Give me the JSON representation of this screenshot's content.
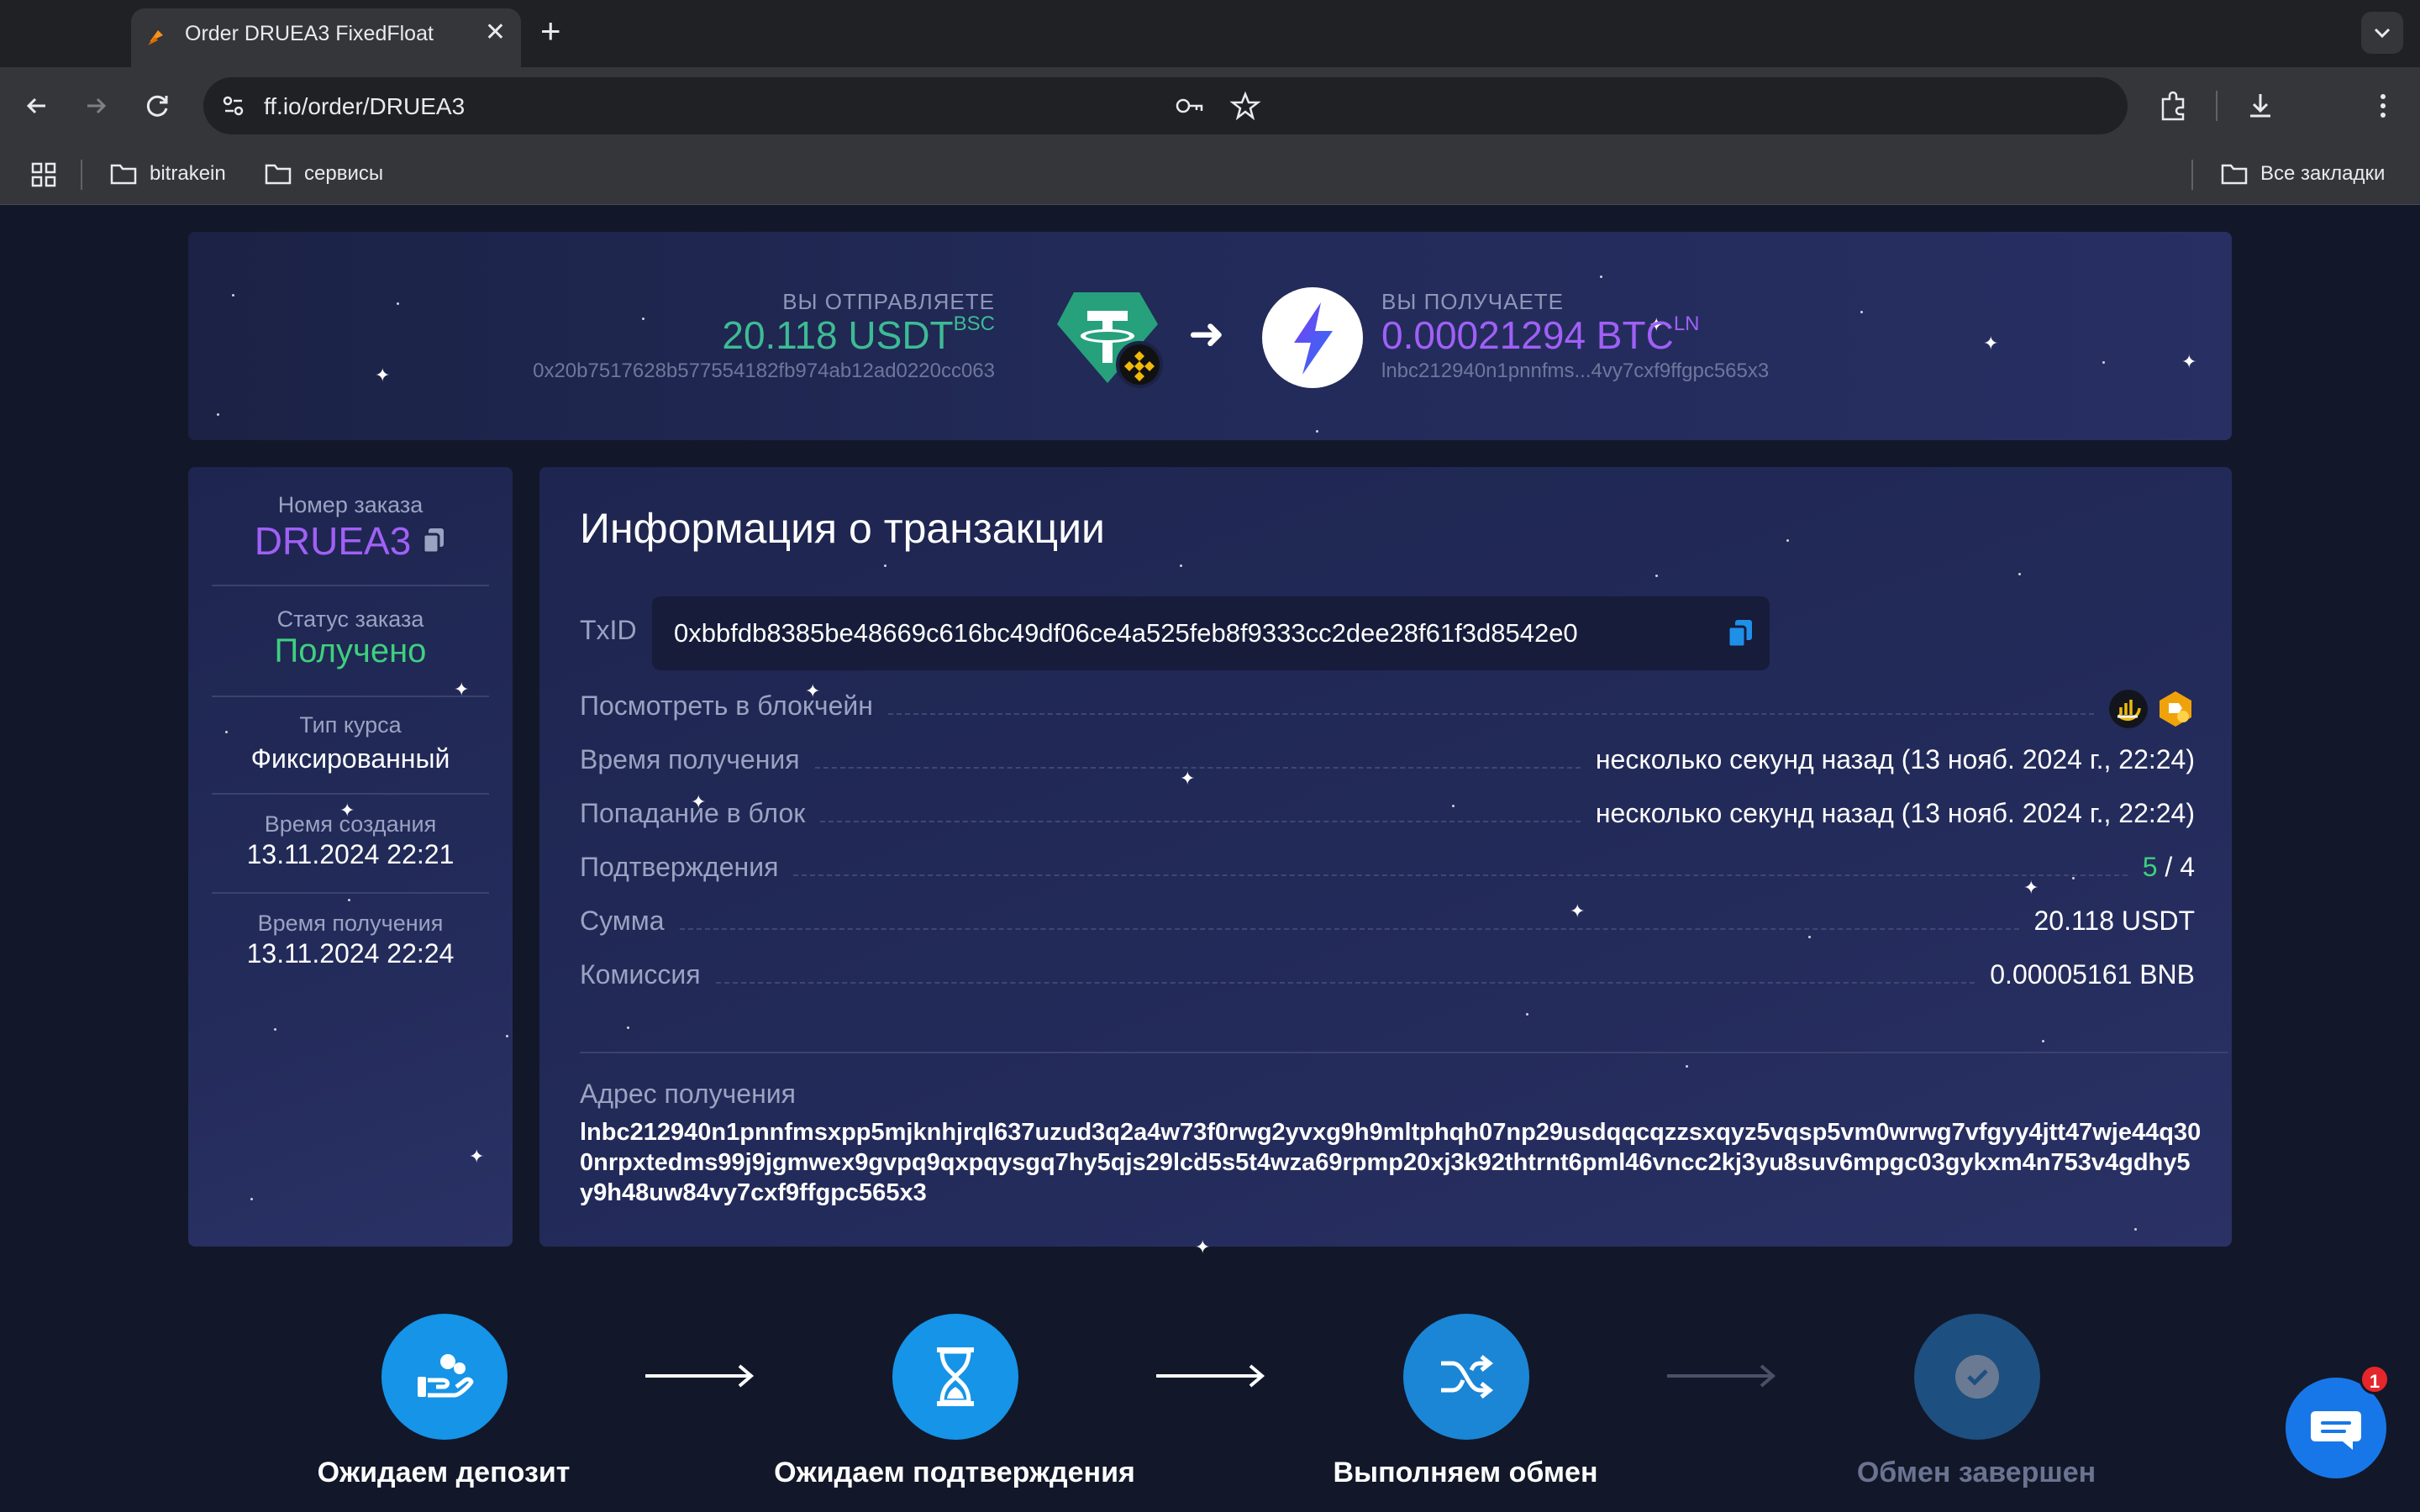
{
  "browser": {
    "tab_title": "Order DRUEA3 FixedFloat",
    "url": "ff.io/order/DRUEA3",
    "bookmarks": [
      "bitrakein",
      "сервисы"
    ],
    "all_bookmarks": "Все закладки"
  },
  "hero": {
    "send_label": "ВЫ ОТПРАВЛЯЕТЕ",
    "send_amount": "20.118 USDT",
    "send_network": "BSC",
    "send_address": "0x20b7517628b577554182fb974ab12ad0220cc063",
    "arrow": "➜",
    "receive_label": "ВЫ ПОЛУЧАЕТЕ",
    "receive_amount": "0.00021294 BTC",
    "receive_network": "LN",
    "receive_address": "lnbc212940n1pnnfms...4vy7cxf9ffgpc565x3",
    "send_color": "#3dbb94",
    "receive_color": "#a060f6"
  },
  "order": {
    "number_label": "Номер заказа",
    "number": "DRUEA3",
    "status_label": "Статус заказа",
    "status": "Получено",
    "rate_label": "Тип курса",
    "rate": "Фиксированный",
    "created_label": "Время создания",
    "created": "13.11.2024 22:21",
    "received_label": "Время получения",
    "received": "13.11.2024 22:24"
  },
  "tx": {
    "title": "Информация о транзакции",
    "txid_label": "TxID",
    "txid": "0xbbfdb8385be48669c616bc49df06ce4a525feb8f9333cc2dee28f61f3d8542e0",
    "rows": {
      "explorer": {
        "label": "Посмотреть в блокчейн"
      },
      "receive_time": {
        "label": "Время получения",
        "value": "несколько секунд назад (13 нояб. 2024 г., 22:24)"
      },
      "block_time": {
        "label": "Попадание в блок",
        "value": "несколько секунд назад (13 нояб. 2024 г., 22:24)"
      },
      "confirmations": {
        "label": "Подтверждения",
        "current": "5",
        "required": "/ 4"
      },
      "amount": {
        "label": "Сумма",
        "value": "20.118 USDT"
      },
      "fee": {
        "label": "Комиссия",
        "value": "0.00005161 BNB"
      }
    },
    "address_label": "Адрес получения",
    "address": "lnbc212940n1pnnfmsxpp5mjknhjrql637uzud3q2a4w73f0rwg2yvxg9h9mltphqh07np29usdqqcqzzsxqyz5vqsp5vm0wrwg7vfgyy4jtt47wje44q300nrpxtedms99j9jgmwex9gvpq9qxpqysgq7hy5qjs29lcd5s5t4wza69rpmp20xj3k92thtrnt6pml46vncc2kj3yu8suv6mpgc03gykxm4n753v4gdhy5y9h48uw84vy7cxf9ffgpc565x3"
  },
  "steps": [
    {
      "label": "Ожидаем депозит",
      "icon": "deposit-hand-icon",
      "state": "done"
    },
    {
      "label": "Ожидаем подтверждения",
      "icon": "hourglass-icon",
      "state": "done"
    },
    {
      "label": "Выполняем обмен",
      "icon": "shuffle-icon",
      "state": "active"
    },
    {
      "label": "Обмен завершен",
      "icon": "check-icon",
      "state": "pending"
    }
  ],
  "chat": {
    "badge": "1"
  }
}
